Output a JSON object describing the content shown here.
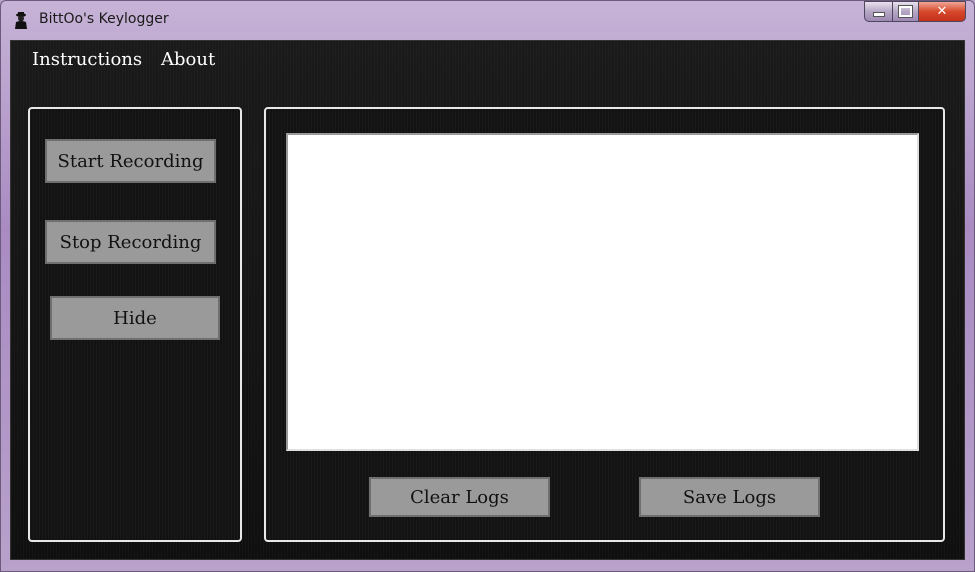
{
  "window": {
    "title": "BittOo's Keylogger",
    "close_glyph": "✕"
  },
  "menu": {
    "items": [
      {
        "label": "Instructions"
      },
      {
        "label": "About"
      }
    ]
  },
  "controls": {
    "start_label": "Start Recording",
    "stop_label": "Stop Recording",
    "hide_label": "Hide"
  },
  "logs": {
    "value": "",
    "clear_label": "Clear Logs",
    "save_label": "Save Logs"
  },
  "colors": {
    "frame": "#b9a2c8",
    "client_background": "#121212",
    "button_gray": "#9a9a9a",
    "close_red": "#d6482c"
  },
  "icons": {
    "app": "spy-figure-icon",
    "minimize": "minimize-icon",
    "maximize": "maximize-icon",
    "close": "close-icon"
  }
}
